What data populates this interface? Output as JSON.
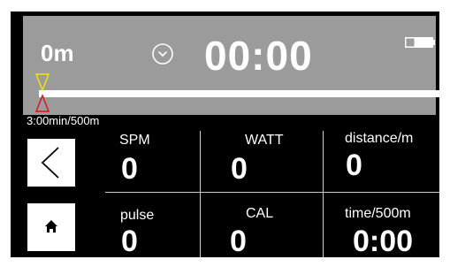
{
  "header": {
    "distance": "0m",
    "time": "00:00",
    "icons": {
      "clock": "clock-icon",
      "battery": "battery-icon"
    }
  },
  "progress": {
    "pace": "3:00min/500m",
    "value": 0
  },
  "nav": {
    "back_icon": "chevron-left-icon",
    "home_icon": "home-icon"
  },
  "metrics": {
    "spm": {
      "label": "SPM",
      "value": "0"
    },
    "watt": {
      "label": "WATT",
      "value": "0"
    },
    "distance": {
      "label": "distance/m",
      "value": "0"
    },
    "pulse": {
      "label": "pulse",
      "value": "0"
    },
    "cal": {
      "label": "CAL",
      "value": "0"
    },
    "split": {
      "label": "time/500m",
      "value": "0:00"
    }
  },
  "colors": {
    "background": "#000000",
    "header_panel": "#9b9b9b",
    "text": "#ffffff",
    "marker_yellow": "#f5e400",
    "marker_red": "#e01010"
  }
}
